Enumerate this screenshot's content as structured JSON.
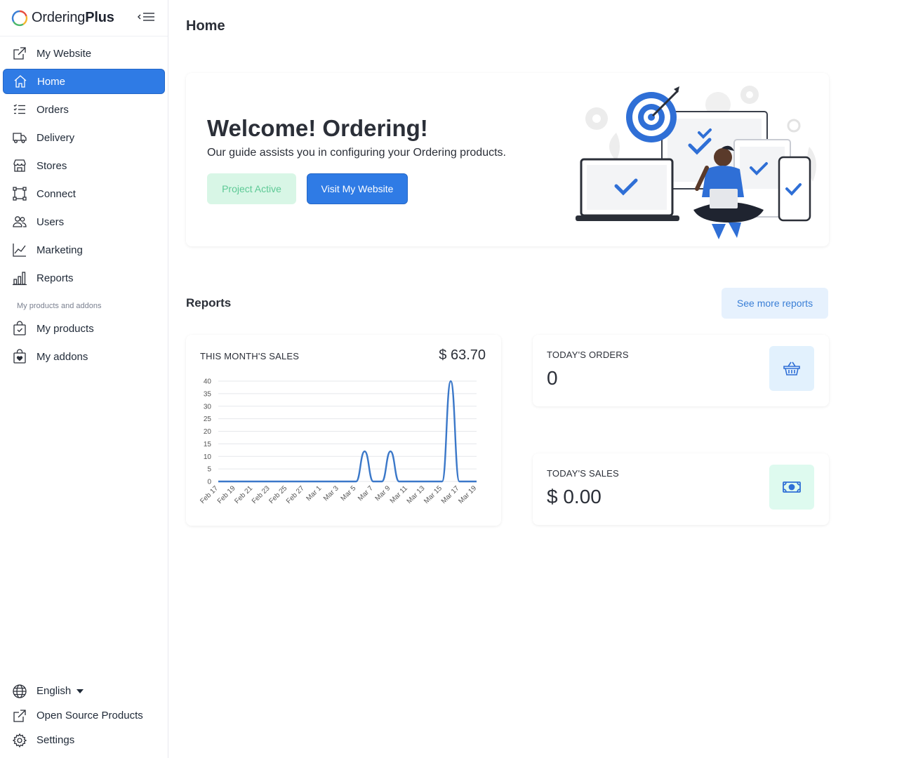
{
  "brand": {
    "name_regular": "Ordering",
    "name_bold": "Plus"
  },
  "sidebar": {
    "items": [
      {
        "label": "My Website",
        "icon": "external-link-icon"
      },
      {
        "label": "Home",
        "icon": "home-icon",
        "active": true
      },
      {
        "label": "Orders",
        "icon": "list-icon"
      },
      {
        "label": "Delivery",
        "icon": "truck-icon"
      },
      {
        "label": "Stores",
        "icon": "shop-icon"
      },
      {
        "label": "Connect",
        "icon": "bounding-box-icon"
      },
      {
        "label": "Users",
        "icon": "people-icon"
      },
      {
        "label": "Marketing",
        "icon": "graph-up-icon"
      },
      {
        "label": "Reports",
        "icon": "bar-chart-icon"
      }
    ],
    "section_label": "My products and addons",
    "products": [
      {
        "label": "My products",
        "icon": "bag-check-icon"
      },
      {
        "label": "My addons",
        "icon": "bag-heart-icon"
      }
    ],
    "bottom": {
      "language": "English",
      "open_source": "Open Source Products",
      "settings": "Settings"
    }
  },
  "page": {
    "title": "Home"
  },
  "welcome": {
    "title": "Welcome! Ordering!",
    "subtitle": "Our guide assists you in configuring your Ordering products.",
    "project_status": "Project Active",
    "visit_button": "Visit My Website"
  },
  "reports": {
    "title": "Reports",
    "see_more": "See more reports",
    "month_sales_label": "THIS MONTH'S SALES",
    "month_sales_value": "$ 63.70",
    "today_orders_label": "TODAY'S ORDERS",
    "today_orders_value": "0",
    "today_sales_label": "TODAY'S SALES",
    "today_sales_value": "$ 0.00"
  },
  "colors": {
    "accent": "#2f7be5",
    "success_bg": "#d8f6e6",
    "success_text": "#5dc995",
    "line": "#3b78c9"
  },
  "chart_data": {
    "type": "line",
    "x": [
      "Feb 17",
      "Feb 18",
      "Feb 19",
      "Feb 20",
      "Feb 21",
      "Feb 22",
      "Feb 23",
      "Feb 24",
      "Feb 25",
      "Feb 26",
      "Feb 27",
      "Feb 28",
      "Mar 1",
      "Mar 2",
      "Mar 3",
      "Mar 4",
      "Mar 5",
      "Mar 6",
      "Mar 7",
      "Mar 8",
      "Mar 9",
      "Mar 10",
      "Mar 11",
      "Mar 12",
      "Mar 13",
      "Mar 14",
      "Mar 15",
      "Mar 16",
      "Mar 17",
      "Mar 18",
      "Mar 19"
    ],
    "xtick_labels": [
      "Feb 17",
      "Feb 19",
      "Feb 21",
      "Feb 23",
      "Feb 25",
      "Feb 27",
      "Mar 1",
      "Mar 3",
      "Mar 5",
      "Mar 7",
      "Mar 9",
      "Mar 11",
      "Mar 13",
      "Mar 15",
      "Mar 17",
      "Mar 19"
    ],
    "values": [
      0,
      0,
      0,
      0,
      0,
      0,
      0,
      0,
      0,
      0,
      0,
      0,
      0,
      0,
      0,
      0,
      0,
      12,
      0,
      0,
      12,
      0,
      0,
      0,
      0,
      0,
      0,
      40,
      0,
      0,
      0
    ],
    "yticks": [
      0,
      5,
      10,
      15,
      20,
      25,
      30,
      35,
      40
    ],
    "ylim": [
      0,
      40
    ],
    "grid": true
  }
}
